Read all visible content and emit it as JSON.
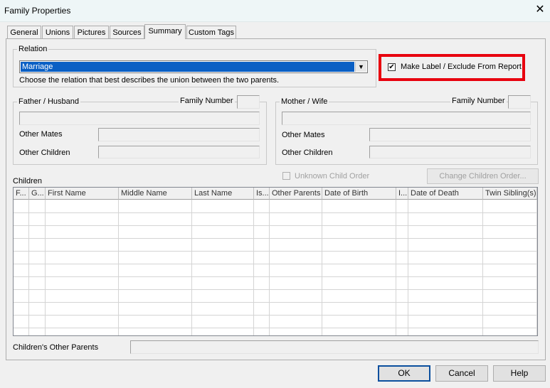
{
  "window": {
    "title": "Family Properties",
    "close_glyph": "✕"
  },
  "tabs": [
    {
      "label": "General"
    },
    {
      "label": "Unions"
    },
    {
      "label": "Pictures"
    },
    {
      "label": "Sources"
    },
    {
      "label": "Summary"
    },
    {
      "label": "Custom Tags"
    }
  ],
  "active_tab": "Summary",
  "relation": {
    "group_label": "Relation",
    "selected": "Marriage",
    "hint": "Choose the relation that best describes the union between the two parents.",
    "arrow_glyph": "▼"
  },
  "make_label": {
    "label": "Make Label / Exclude From Report",
    "checked": true,
    "check_glyph": "✔"
  },
  "father": {
    "group_label": "Father / Husband",
    "family_number_label": "Family Number",
    "other_mates_label": "Other Mates",
    "other_children_label": "Other Children"
  },
  "mother": {
    "group_label": "Mother / Wife",
    "family_number_label": "Family Number",
    "other_mates_label": "Other Mates",
    "other_children_label": "Other Children"
  },
  "children": {
    "label": "Children",
    "unknown_order_label": "Unknown Child Order",
    "change_order_button": "Change Children Order...",
    "columns": [
      "F...",
      "G...",
      "First Name",
      "Middle Name",
      "Last Name",
      "Is...",
      "Other Parents",
      "Date of Birth",
      "I...",
      "Date of Death",
      "Twin Sibling(s)"
    ],
    "other_parents_label": "Children's Other Parents"
  },
  "footer": {
    "ok": "OK",
    "cancel": "Cancel",
    "help": "Help"
  }
}
